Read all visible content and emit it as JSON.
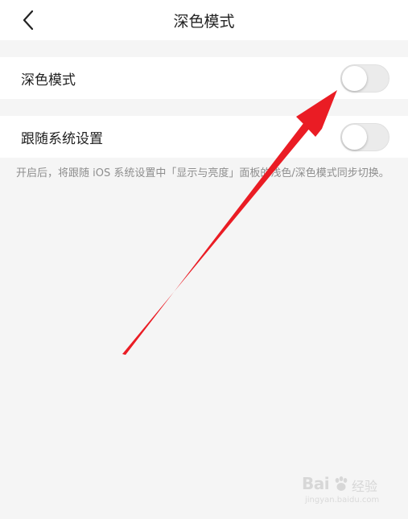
{
  "header": {
    "back_icon": "chevron-left-icon",
    "title": "深色模式"
  },
  "settings": {
    "dark_mode": {
      "label": "深色模式",
      "enabled": false
    },
    "follow_system": {
      "label": "跟随系统设置",
      "enabled": false
    },
    "hint": "开启后，将跟随 iOS 系统设置中「显示与亮度」面板的浅色/深色模式同步切换。"
  },
  "annotation": {
    "arrow_icon": "red-arrow-icon",
    "color": "#ea1c24"
  },
  "watermark": {
    "logo": "Bai",
    "text": "经验",
    "url": "jingyan.baidu.com"
  }
}
